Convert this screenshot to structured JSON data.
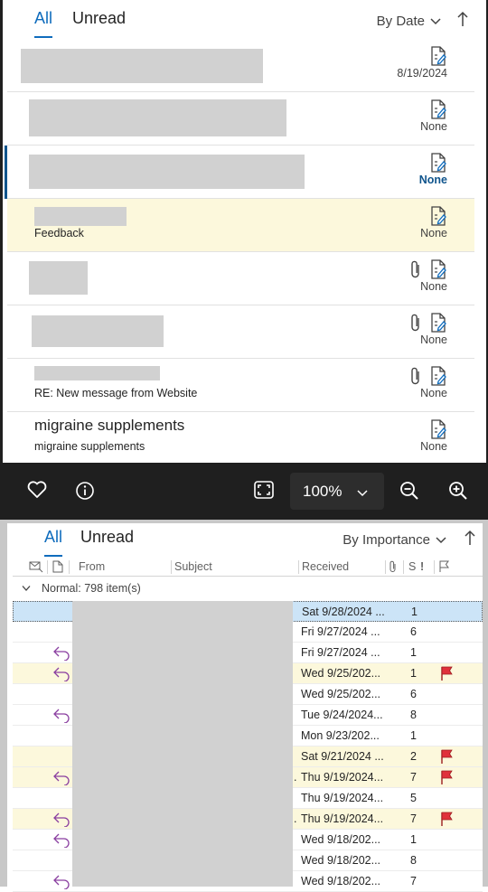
{
  "top_list": {
    "tabs": [
      {
        "label": "All",
        "active": true
      },
      {
        "label": "Unread",
        "active": false
      }
    ],
    "sort_label": "By Date",
    "items": [
      {
        "subject": "",
        "due": "8/19/2024",
        "attachment": false,
        "highlight": false,
        "selected": false,
        "due_bold": false
      },
      {
        "subject": "",
        "due": "None",
        "attachment": false,
        "highlight": false,
        "selected": false,
        "due_bold": false
      },
      {
        "subject": "",
        "due": "None",
        "attachment": false,
        "highlight": false,
        "selected": true,
        "due_bold": true
      },
      {
        "subject": "Feedback",
        "due": "None",
        "attachment": false,
        "highlight": true,
        "selected": false,
        "due_bold": false
      },
      {
        "subject": "",
        "due": "None",
        "attachment": true,
        "highlight": false,
        "selected": false,
        "due_bold": false
      },
      {
        "subject": "",
        "due": "None",
        "attachment": true,
        "highlight": false,
        "selected": false,
        "due_bold": false
      },
      {
        "subject": "RE: New message from Website",
        "due": "None",
        "attachment": true,
        "highlight": false,
        "selected": false,
        "due_bold": false
      },
      {
        "sender": "migraine supplements",
        "subject": "migraine supplements",
        "due": "None",
        "attachment": false,
        "highlight": false,
        "selected": false,
        "due_bold": false
      }
    ]
  },
  "toolbar": {
    "zoom": "100%",
    "icons": [
      "heart-icon",
      "info-icon",
      "fit-screen-icon",
      "zoom-out-icon",
      "zoom-in-icon"
    ]
  },
  "bottom_list": {
    "tabs": [
      {
        "label": "All",
        "active": true
      },
      {
        "label": "Unread",
        "active": false
      }
    ],
    "sort_label": "By Importance",
    "columns": {
      "from": "From",
      "subject": "Subject",
      "received": "Received",
      "size": "S",
      "importance": "!"
    },
    "group_label": "Normal: 798 item(s)",
    "rows": [
      {
        "received": "Sat 9/28/2024 ...",
        "size": "1",
        "reply": false,
        "flag": false,
        "highlight": false,
        "selected": true,
        "dot": false
      },
      {
        "received": "Fri 9/27/2024 ...",
        "size": "6",
        "reply": false,
        "flag": false,
        "highlight": false,
        "selected": false,
        "dot": false
      },
      {
        "received": "Fri 9/27/2024 ...",
        "size": "1",
        "reply": true,
        "flag": false,
        "highlight": false,
        "selected": false,
        "dot": false
      },
      {
        "received": "Wed 9/25/202...",
        "size": "1",
        "reply": true,
        "flag": true,
        "highlight": true,
        "selected": false,
        "dot": false
      },
      {
        "received": "Wed 9/25/202...",
        "size": "6",
        "reply": false,
        "flag": false,
        "highlight": false,
        "selected": false,
        "dot": false
      },
      {
        "received": "Tue 9/24/2024...",
        "size": "8",
        "reply": true,
        "flag": false,
        "highlight": false,
        "selected": false,
        "dot": false
      },
      {
        "received": "Mon 9/23/202...",
        "size": "1",
        "reply": false,
        "flag": false,
        "highlight": false,
        "selected": false,
        "dot": false
      },
      {
        "received": "Sat 9/21/2024 ...",
        "size": "2",
        "reply": false,
        "flag": true,
        "highlight": true,
        "selected": false,
        "dot": false
      },
      {
        "received": "Thu 9/19/2024...",
        "size": "7",
        "reply": true,
        "flag": true,
        "highlight": true,
        "selected": false,
        "dot": true
      },
      {
        "received": "Thu 9/19/2024...",
        "size": "5",
        "reply": false,
        "flag": false,
        "highlight": false,
        "selected": false,
        "dot": false
      },
      {
        "received": "Thu 9/19/2024...",
        "size": "7",
        "reply": true,
        "flag": true,
        "highlight": true,
        "selected": false,
        "dot": true
      },
      {
        "received": "Wed 9/18/202...",
        "size": "1",
        "reply": true,
        "flag": false,
        "highlight": false,
        "selected": false,
        "dot": false
      },
      {
        "received": "Wed 9/18/202...",
        "size": "8",
        "reply": false,
        "flag": false,
        "highlight": false,
        "selected": false,
        "dot": false
      },
      {
        "received": "Wed 9/18/202...",
        "size": "7",
        "reply": true,
        "flag": false,
        "highlight": false,
        "selected": false,
        "dot": false
      }
    ]
  },
  "colors": {
    "accent": "#0f6cbd",
    "highlight": "#fcf8dc",
    "selected": "#cce4f7",
    "flag": "#e0313b",
    "reply": "#8a3fa0",
    "toolbar": "#1f1f1f"
  }
}
